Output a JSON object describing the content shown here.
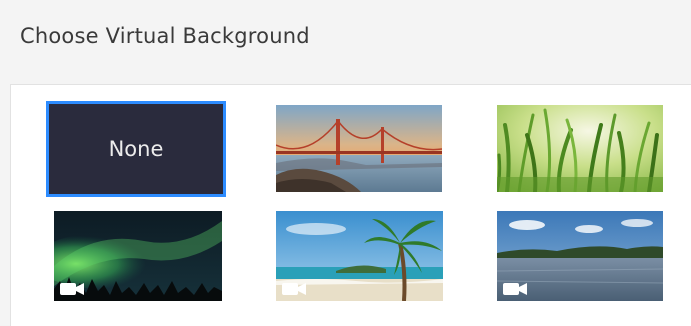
{
  "dialog": {
    "title": "Choose Virtual Background"
  },
  "backgrounds": [
    {
      "id": "none",
      "label": "None",
      "selected": true
    },
    {
      "id": "golden-gate",
      "selected": false,
      "video": false
    },
    {
      "id": "grass",
      "selected": false,
      "video": false
    },
    {
      "id": "aurora",
      "selected": false,
      "video": true
    },
    {
      "id": "beach",
      "selected": false,
      "video": true
    },
    {
      "id": "lake",
      "selected": false,
      "video": true
    }
  ],
  "colors": {
    "selection_border": "#2d8cff",
    "none_tile_bg": "#2a2b3d"
  },
  "icons": {
    "video_badge": "video-camera-icon"
  }
}
